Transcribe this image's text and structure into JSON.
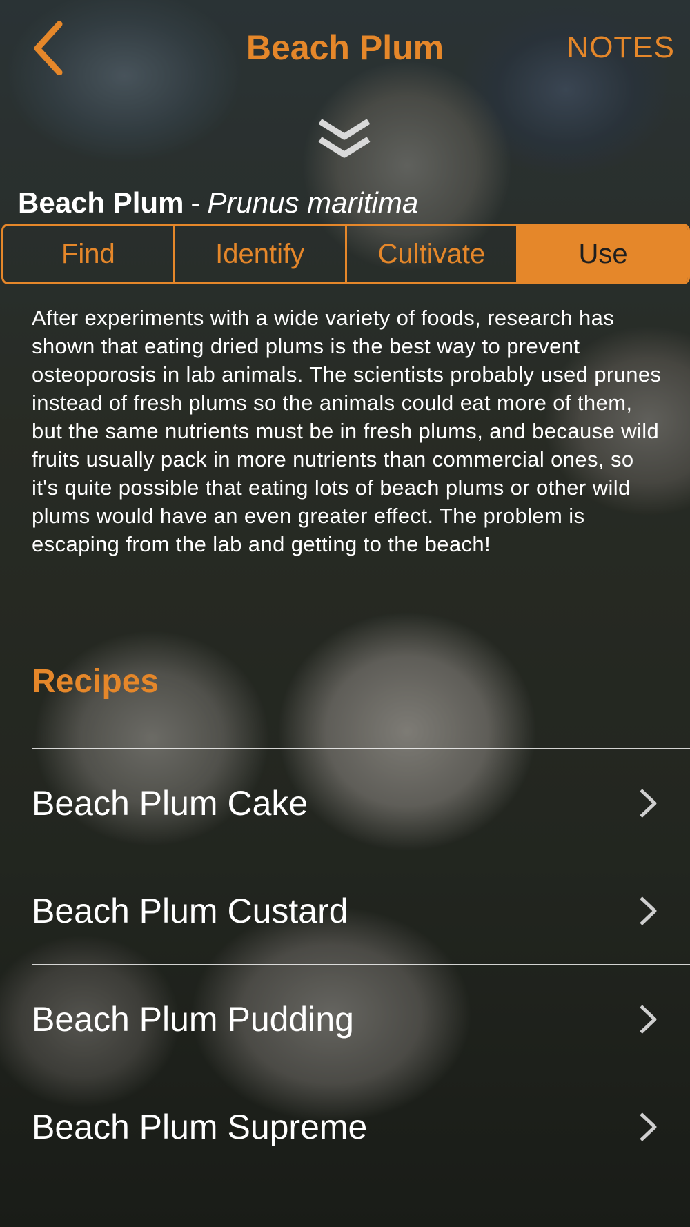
{
  "nav": {
    "title": "Beach Plum",
    "notes_label": "NOTES",
    "back_icon": "chevron-left-icon",
    "collapse_icon": "double-chevron-down-icon"
  },
  "species": {
    "common_name": "Beach Plum",
    "separator": "-",
    "latin_name": "Prunus maritima"
  },
  "tabs": [
    {
      "label": "Find"
    },
    {
      "label": "Identify"
    },
    {
      "label": "Cultivate"
    },
    {
      "label": "Use",
      "active": true
    }
  ],
  "description": "After experiments with a wide variety of foods, research has shown that eating dried plums is the best way to prevent osteoporosis in lab animals. The scientists probably used prunes instead of fresh plums so the animals could eat more of them, but the same nutrients must be in fresh plums, and because wild fruits usually pack in more nutrients than commercial ones, so it's quite possible that eating lots of beach plums or other wild plums would have an even greater effect. The problem is escaping from the lab and getting to the beach!",
  "recipes": {
    "title": "Recipes",
    "items": [
      {
        "label": "Beach Plum Cake"
      },
      {
        "label": "Beach Plum Custard"
      },
      {
        "label": "Beach Plum Pudding"
      },
      {
        "label": "Beach Plum Supreme"
      }
    ]
  },
  "colors": {
    "accent": "#e5872a",
    "text": "#ffffff",
    "active_tab_text": "#1f1f1f"
  }
}
